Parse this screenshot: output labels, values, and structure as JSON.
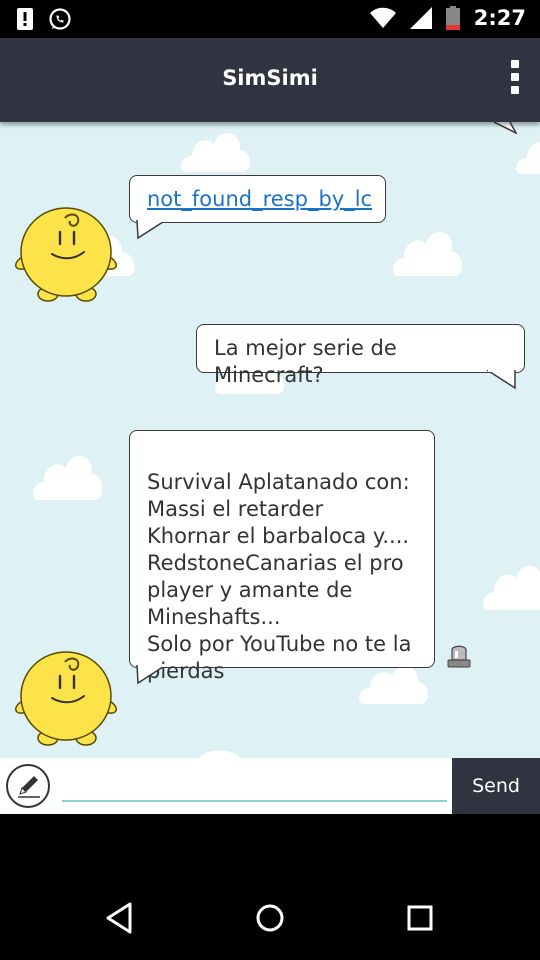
{
  "status_bar": {
    "time": "2:27",
    "icons": [
      "alert-icon",
      "whatsapp-icon",
      "wifi-icon",
      "signal-icon",
      "battery-icon"
    ]
  },
  "app_bar": {
    "title": "SimSimi",
    "menu_icon": "overflow-menu-icon"
  },
  "messages": [
    {
      "sender": "simsimi",
      "text": "not_found_resp_by_lc",
      "is_link": true
    },
    {
      "sender": "user",
      "text": "La mejor serie de Minecraft?"
    },
    {
      "sender": "simsimi",
      "text": "Survival Aplatanado con:\nMassi el retarder\nKhornar el barbaloca y....\nRedstoneCanarias el pro\nplayer  y amante de\nMineshafts...\nSolo por YouTube no te la\npierdas"
    }
  ],
  "input_bar": {
    "value": "",
    "placeholder": "",
    "send_label": "Send"
  },
  "colors": {
    "app_bar": "#2f3440",
    "chat_bg": "#def2f5",
    "link": "#1a73c8",
    "input_underline": "#8bcfcf",
    "character": "#fde34a"
  },
  "nav_bar": {
    "icons": [
      "back-icon",
      "home-icon",
      "recents-icon"
    ]
  }
}
